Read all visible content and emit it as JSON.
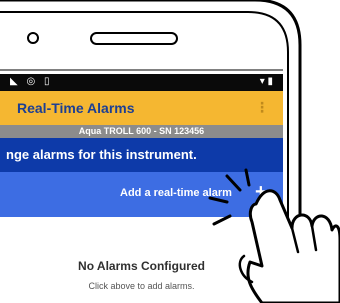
{
  "status_bar": {
    "left_icons": "◣ ◎ ▯",
    "right_icons": "▾ ▮"
  },
  "app_bar": {
    "title": "Real-Time Alarms",
    "menu_icon": "⋮"
  },
  "instrument": {
    "label": "Aqua TROLL 600 - SN 123456"
  },
  "banner": {
    "message": "nge alarms for this instrument."
  },
  "action_bar": {
    "add_label": "Add a real-time alarm",
    "add_icon": "+"
  },
  "empty_state": {
    "title": "No Alarms Configured",
    "subtitle": "Click above to add alarms."
  },
  "colors": {
    "app_bar": "#f5b731",
    "title_text": "#1c3f94",
    "instrument_bar": "#8c8c8c",
    "banner": "#0d3aa9",
    "action_bar": "#3d6de3"
  }
}
